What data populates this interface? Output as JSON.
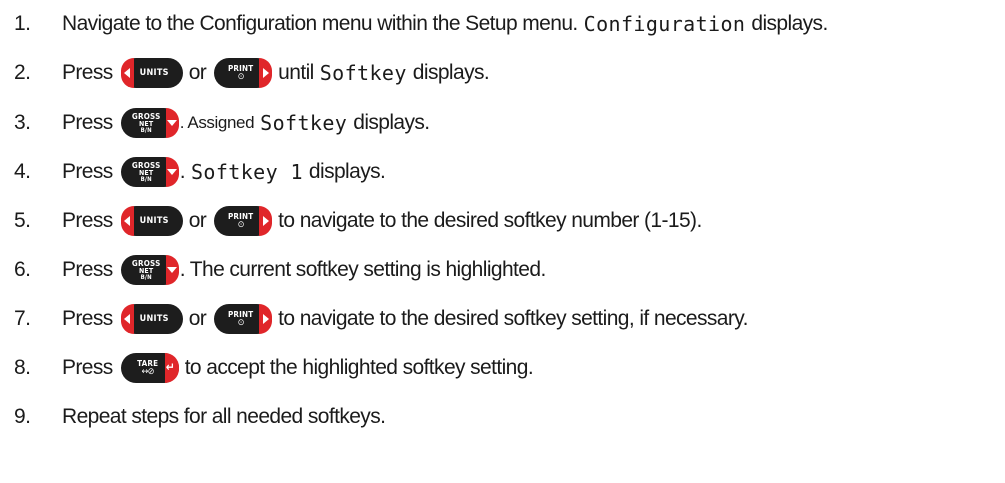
{
  "keys": {
    "units": {
      "label": "UNITS"
    },
    "print": {
      "label": "PRINT",
      "glyph": "⊙"
    },
    "gross": {
      "line1": "GROSS",
      "line2": "NET",
      "line3": "B/N"
    },
    "tare": {
      "label": "TARE",
      "glyph": "↔⊘"
    }
  },
  "steps": [
    {
      "num": "1.",
      "text_a": "Navigate to the Configuration menu within the Setup menu.",
      "mono_a": "Configuration",
      "text_b": "displays."
    },
    {
      "num": "2.",
      "text_a": "Press",
      "or": "or",
      "text_b": "until",
      "mono_a": "Softkey",
      "text_c": "displays."
    },
    {
      "num": "3.",
      "text_a": "Press",
      "text_b": ". Assigned",
      "mono_a": "Softkey",
      "text_c": "displays."
    },
    {
      "num": "4.",
      "text_a": "Press",
      "text_b": ".",
      "mono_a": "Softkey 1",
      "text_c": "displays."
    },
    {
      "num": "5.",
      "text_a": "Press",
      "or": "or",
      "text_b": "to navigate to the desired softkey number (1-15)."
    },
    {
      "num": "6.",
      "text_a": "Press",
      "text_b": ". The current softkey setting is highlighted."
    },
    {
      "num": "7.",
      "text_a": "Press",
      "or": "or",
      "text_b": "to navigate to the desired softkey setting, if necessary."
    },
    {
      "num": "8.",
      "text_a": "Press",
      "text_b": "to accept the highlighted softkey setting."
    },
    {
      "num": "9.",
      "text_a": "Repeat steps for all needed softkeys."
    }
  ],
  "colors": {
    "key_body": "#1d1d1d",
    "key_accent": "#e0262a",
    "text": "#1b1b1b"
  }
}
